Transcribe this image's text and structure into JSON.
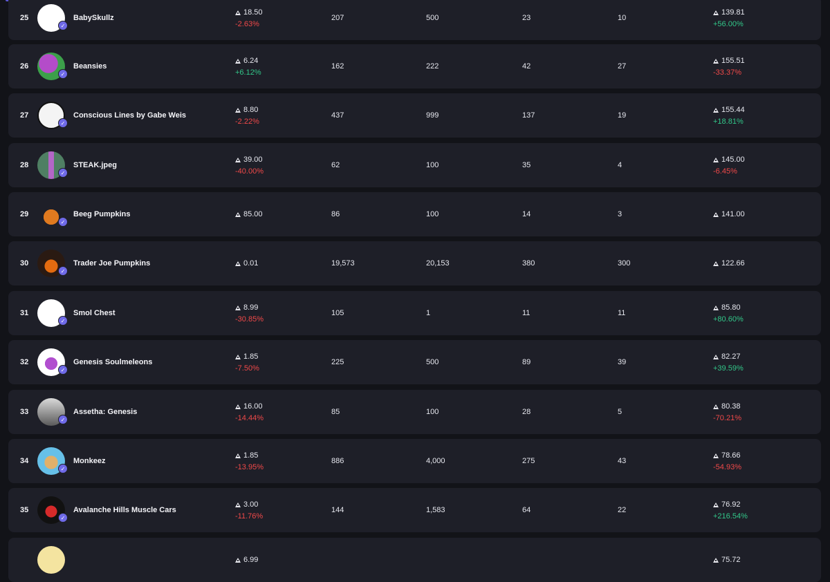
{
  "colors": {
    "positive": "#32c789",
    "negative": "#f04949",
    "row_bg": "#1e1f28",
    "page_bg": "#121318"
  },
  "rows": [
    {
      "rank": "25",
      "name": "BabySkullz",
      "price": "18.50",
      "price_change": "-2.63%",
      "price_trend": "neg",
      "owners": "207",
      "supply": "500",
      "sales": "23",
      "listed": "10",
      "volume": "139.81",
      "volume_change": "+56.00%",
      "volume_trend": "pos",
      "icon": "skull-icon"
    },
    {
      "rank": "26",
      "name": "Beansies",
      "price": "6.24",
      "price_change": "+6.12%",
      "price_trend": "pos",
      "owners": "162",
      "supply": "222",
      "sales": "42",
      "listed": "27",
      "volume": "155.51",
      "volume_change": "-33.37%",
      "volume_trend": "neg",
      "icon": "bean-icon"
    },
    {
      "rank": "27",
      "name": "Conscious Lines by Gabe Weis",
      "price": "8.80",
      "price_change": "-2.22%",
      "price_trend": "neg",
      "owners": "437",
      "supply": "999",
      "sales": "137",
      "listed": "19",
      "volume": "155.44",
      "volume_change": "+18.81%",
      "volume_trend": "pos",
      "icon": "lines-icon"
    },
    {
      "rank": "28",
      "name": "STEAK.jpeg",
      "price": "39.00",
      "price_change": "-40.00%",
      "price_trend": "neg",
      "owners": "62",
      "supply": "100",
      "sales": "35",
      "listed": "4",
      "volume": "145.00",
      "volume_change": "-6.45%",
      "volume_trend": "neg",
      "icon": "steak-icon"
    },
    {
      "rank": "29",
      "name": "Beeg Pumpkins",
      "price": "85.00",
      "price_change": "",
      "price_trend": "none",
      "owners": "86",
      "supply": "100",
      "sales": "14",
      "listed": "3",
      "volume": "141.00",
      "volume_change": "",
      "volume_trend": "none",
      "icon": "pumpkin-icon"
    },
    {
      "rank": "30",
      "name": "Trader Joe Pumpkins",
      "price": "0.01",
      "price_change": "",
      "price_trend": "none",
      "owners": "19,573",
      "supply": "20,153",
      "sales": "380",
      "listed": "300",
      "volume": "122.66",
      "volume_change": "",
      "volume_trend": "none",
      "icon": "jack-o-lantern-icon"
    },
    {
      "rank": "31",
      "name": "Smol Chest",
      "price": "8.99",
      "price_change": "-30.85%",
      "price_trend": "neg",
      "owners": "105",
      "supply": "1",
      "sales": "11",
      "listed": "11",
      "volume": "85.80",
      "volume_change": "+80.60%",
      "volume_trend": "pos",
      "icon": "chest-icon"
    },
    {
      "rank": "32",
      "name": "Genesis Soulmeleons",
      "price": "1.85",
      "price_change": "-7.50%",
      "price_trend": "neg",
      "owners": "225",
      "supply": "500",
      "sales": "89",
      "listed": "39",
      "volume": "82.27",
      "volume_change": "+39.59%",
      "volume_trend": "pos",
      "icon": "wizard-hat-icon"
    },
    {
      "rank": "33",
      "name": "Assetha: Genesis",
      "price": "16.00",
      "price_change": "-14.44%",
      "price_trend": "neg",
      "owners": "85",
      "supply": "100",
      "sales": "28",
      "listed": "5",
      "volume": "80.38",
      "volume_change": "-70.21%",
      "volume_trend": "neg",
      "icon": "character-icon"
    },
    {
      "rank": "34",
      "name": "Monkeez",
      "price": "1.85",
      "price_change": "-13.95%",
      "price_trend": "neg",
      "owners": "886",
      "supply": "4,000",
      "sales": "275",
      "listed": "43",
      "volume": "78.66",
      "volume_change": "-54.93%",
      "volume_trend": "neg",
      "icon": "monkey-icon"
    },
    {
      "rank": "35",
      "name": "Avalanche Hills Muscle Cars",
      "price": "3.00",
      "price_change": "-11.76%",
      "price_trend": "neg",
      "owners": "144",
      "supply": "1,583",
      "sales": "64",
      "listed": "22",
      "volume": "76.92",
      "volume_change": "+216.54%",
      "volume_trend": "pos",
      "icon": "mountain-logo-icon"
    },
    {
      "rank": "",
      "name": "",
      "price": "6.99",
      "price_change": "",
      "price_trend": "none",
      "owners": "",
      "supply": "",
      "sales": "",
      "listed": "",
      "volume": "75.72",
      "volume_change": "",
      "volume_trend": "none",
      "icon": "partial-avatar-icon"
    }
  ]
}
